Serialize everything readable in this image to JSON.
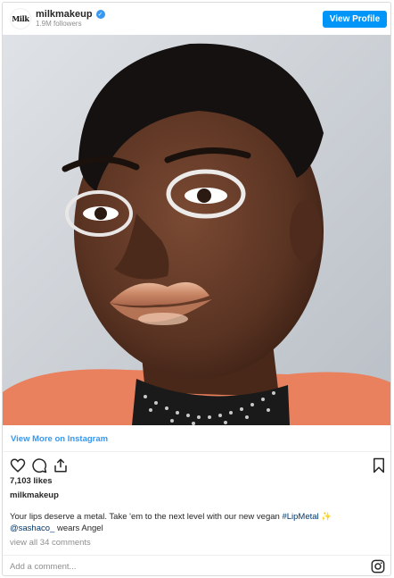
{
  "header": {
    "avatar_text": "Milk",
    "username": "milkmakeup",
    "verified_mark": "✓",
    "followers": "1.9M followers",
    "view_profile_label": "View Profile"
  },
  "photo": {
    "alt_icon": "portrait-photo"
  },
  "view_more_label": "View More on Instagram",
  "actions": {
    "icons": [
      "heart-icon",
      "comment-icon",
      "share-icon",
      "bookmark-icon"
    ]
  },
  "likes": "7,103 likes",
  "caption": {
    "username": "milkmakeup",
    "text_part1": "Your lips deserve a metal. Take 'em to the next level with our new vegan ",
    "hashtag": "#LipMetal",
    "sparkle": "✨",
    "mention": "@sashaco_",
    "text_part2": " wears Angel"
  },
  "view_comments": "view all 34 comments",
  "comment_placeholder": "Add a comment...",
  "colors": {
    "accent": "#0095f6",
    "link": "#00376b",
    "muted": "#8e8e8e",
    "border": "#dbdbdb"
  }
}
